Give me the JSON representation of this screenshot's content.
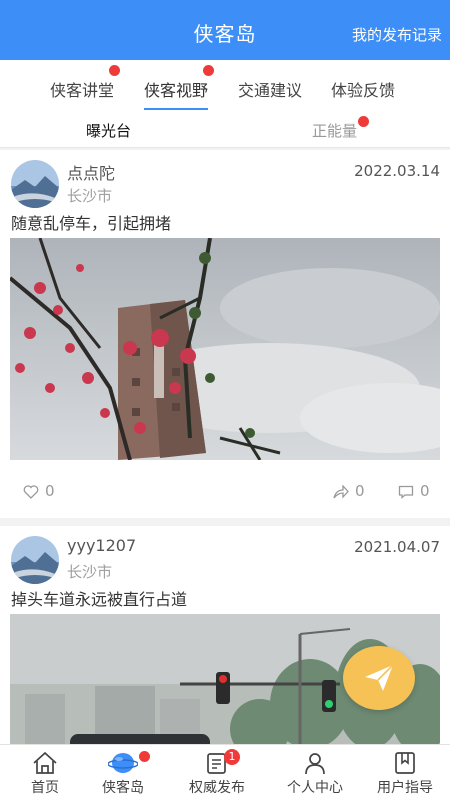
{
  "header": {
    "title": "侠客岛",
    "record_link": "我的发布记录"
  },
  "tabs": [
    {
      "label": "侠客讲堂",
      "dot": true
    },
    {
      "label": "侠客视野",
      "dot": true,
      "active": true
    },
    {
      "label": "交通建议",
      "dot": false
    },
    {
      "label": "体验反馈",
      "dot": false
    }
  ],
  "subtabs": [
    {
      "label": "曝光台",
      "active": true
    },
    {
      "label": "正能量",
      "dot": true
    }
  ],
  "posts": [
    {
      "user": "点点陀",
      "city": "长沙市",
      "date": "2022.03.14",
      "text": "随意乱停车，引起拥堵",
      "likes": "0",
      "shares": "0",
      "comments": "0"
    },
    {
      "user": "yyy1207",
      "city": "长沙市",
      "date": "2021.04.07",
      "text": "掉头车道永远被直行占道"
    }
  ],
  "fab": {
    "icon": "paper-plane-icon"
  },
  "bottom_nav": [
    {
      "label": "首页",
      "icon": "home-icon"
    },
    {
      "label": "侠客岛",
      "icon": "planet-icon",
      "active": true,
      "dot": true
    },
    {
      "label": "权威发布",
      "icon": "document-icon",
      "badge": "1"
    },
    {
      "label": "个人中心",
      "icon": "user-icon"
    },
    {
      "label": "用户指导",
      "icon": "bookmark-icon"
    }
  ],
  "colors": {
    "primary": "#3d8ef6",
    "badge": "#f03a3a",
    "fab": "#f6c155"
  }
}
